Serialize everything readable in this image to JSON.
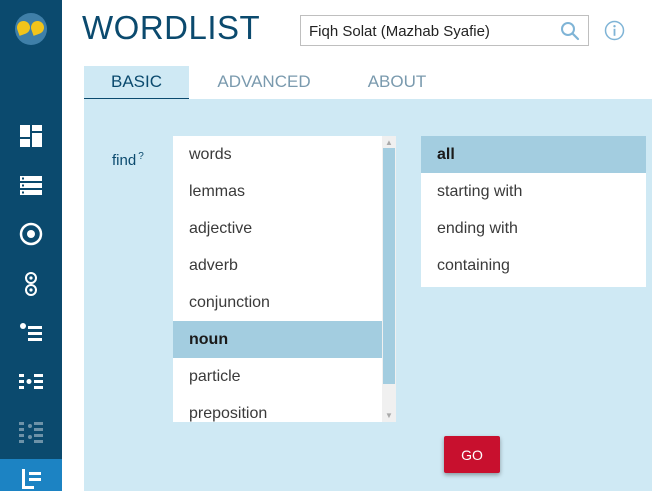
{
  "app": {
    "title": "WORDLIST"
  },
  "corpus": {
    "value": "Fiqh Solat (Mazhab Syafie)"
  },
  "tabs": [
    {
      "label": "BASIC",
      "active": true
    },
    {
      "label": "ADVANCED",
      "active": false
    },
    {
      "label": "ABOUT",
      "active": false
    }
  ],
  "find": {
    "label": "find",
    "help": "?"
  },
  "wordtypes": [
    {
      "label": "words",
      "selected": false
    },
    {
      "label": "lemmas",
      "selected": false
    },
    {
      "label": "adjective",
      "selected": false
    },
    {
      "label": "adverb",
      "selected": false
    },
    {
      "label": "conjunction",
      "selected": false
    },
    {
      "label": "noun",
      "selected": true
    },
    {
      "label": "particle",
      "selected": false
    },
    {
      "label": "preposition",
      "selected": false
    }
  ],
  "filters": [
    {
      "label": "all",
      "selected": true
    },
    {
      "label": "starting with",
      "selected": false
    },
    {
      "label": "ending with",
      "selected": false
    },
    {
      "label": "containing",
      "selected": false
    }
  ],
  "go": {
    "label": "GO"
  },
  "sidebar": {
    "icons": [
      "dashboard-icon",
      "list-icon",
      "concordance-icon",
      "collocations-icon",
      "wordlist-bullets-icon",
      "ngrams-icon",
      "keywords-icon",
      "wordlist-icon"
    ],
    "active_index": 7
  },
  "colors": {
    "primary": "#0b4a6e",
    "panel": "#cfe9f4",
    "selection": "#a3cde0",
    "go_button": "#c8102e",
    "active_sidebar": "#1c83c3"
  }
}
